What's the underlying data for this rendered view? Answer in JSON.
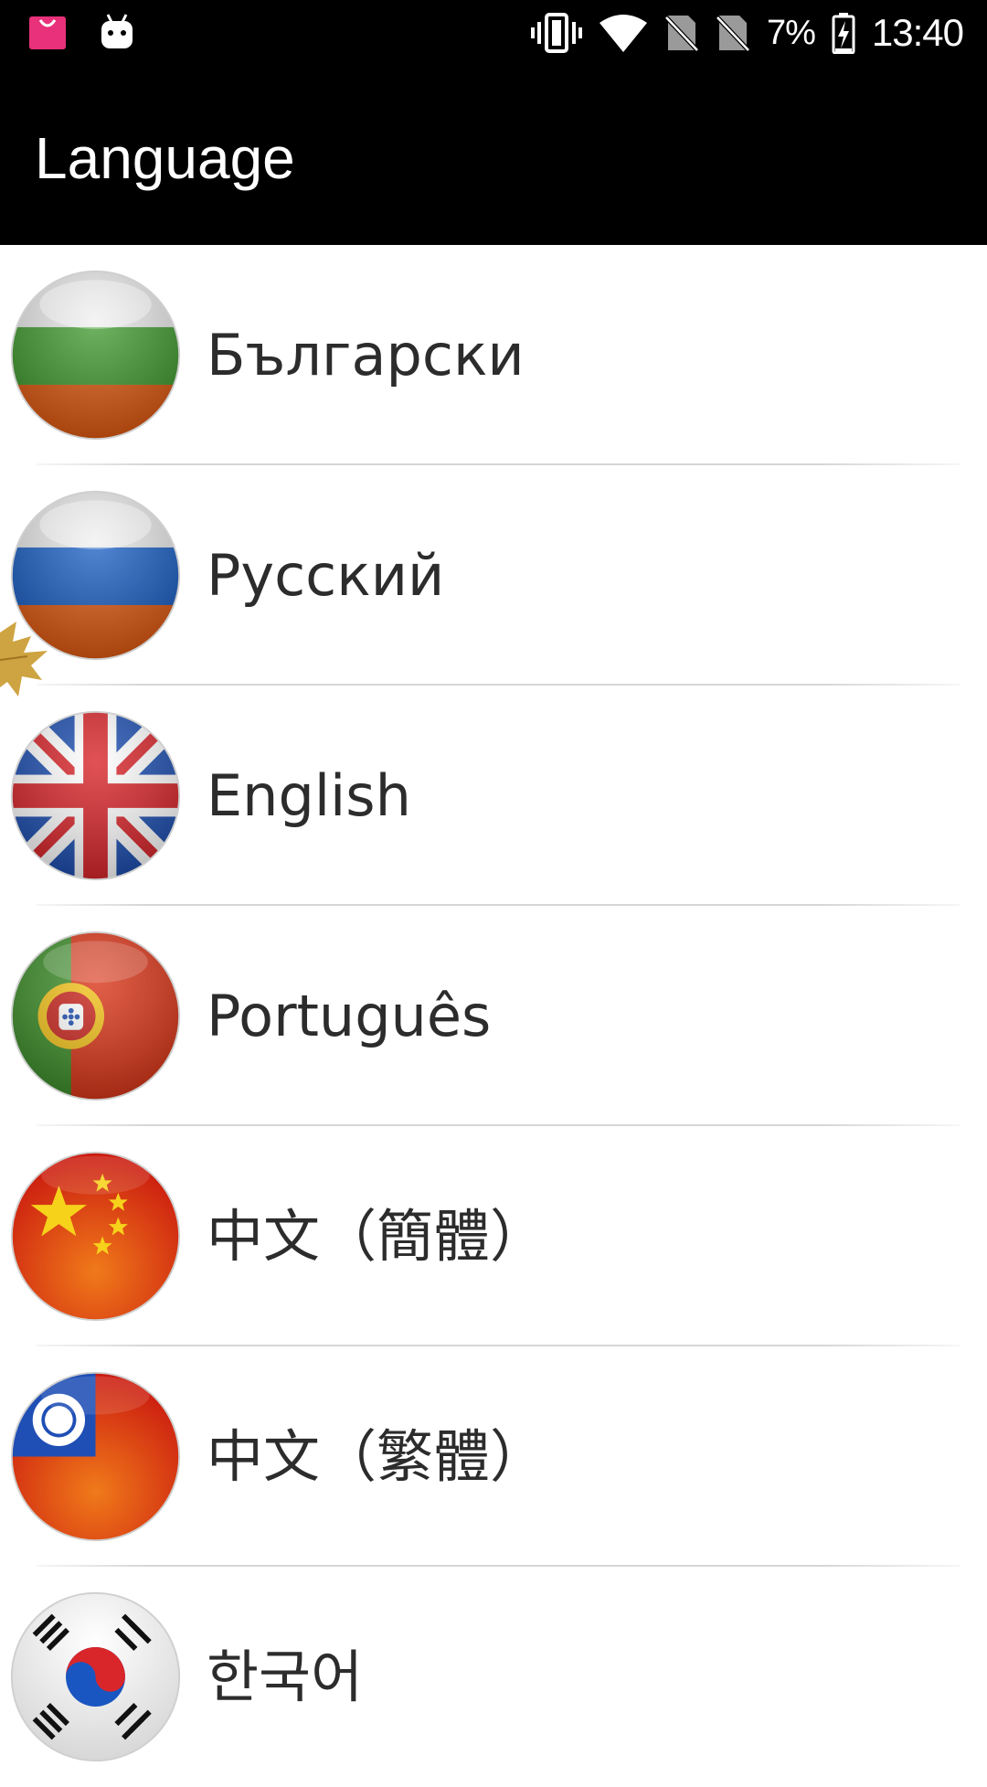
{
  "status_bar": {
    "battery": "7%",
    "time": "13:40",
    "icons": [
      "shopping-bag-icon",
      "android-icon",
      "vibrate-icon",
      "wifi-icon",
      "no-sim-icon",
      "no-sim-icon",
      "battery-charging-icon"
    ]
  },
  "toolbar": {
    "title": "Language"
  },
  "languages": [
    {
      "label": "Български",
      "flag": "bulgaria-flag-icon"
    },
    {
      "label": "Русский",
      "flag": "russia-flag-icon"
    },
    {
      "label": "English",
      "flag": "uk-flag-icon"
    },
    {
      "label": "Português",
      "flag": "portugal-flag-icon"
    },
    {
      "label": "中文（簡體）",
      "flag": "china-flag-icon"
    },
    {
      "label": "中文（繁體）",
      "flag": "taiwan-flag-icon"
    },
    {
      "label": "한국어",
      "flag": "korea-flag-icon"
    }
  ],
  "colors": {
    "bar_bg": "#000000",
    "list_bg": "#ffffff",
    "text": "#2c2c2c"
  }
}
